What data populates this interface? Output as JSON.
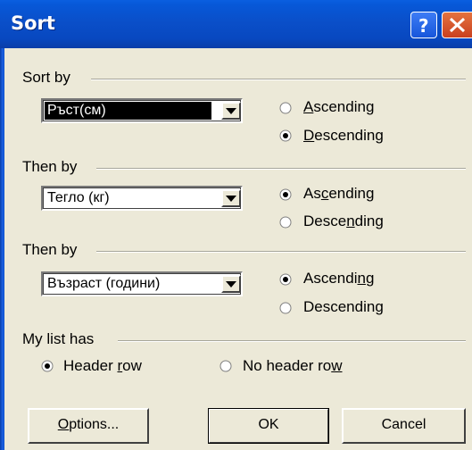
{
  "window": {
    "title": "Sort"
  },
  "sort_by": {
    "heading": "Sort by",
    "field": "Ръст(см)",
    "ascending": {
      "pre": "",
      "u": "A",
      "post": "scending",
      "checked": false
    },
    "descending": {
      "pre": "",
      "u": "D",
      "post": "escending",
      "checked": true
    }
  },
  "then_by_1": {
    "heading": "Then by",
    "field": "Тегло (кг)",
    "ascending": {
      "pre": "As",
      "u": "c",
      "post": "ending",
      "checked": true
    },
    "descending": {
      "pre": "Desce",
      "u": "n",
      "post": "ding",
      "checked": false
    }
  },
  "then_by_2": {
    "heading": "Then by",
    "field": "Възраст (години)",
    "ascending": {
      "pre": "Ascendi",
      "u": "n",
      "post": "g",
      "checked": true
    },
    "descending": {
      "pre": "Descendin",
      "u": "g",
      "post": "",
      "checked": false
    }
  },
  "header": {
    "heading": "My list has",
    "header_row": {
      "pre": "Header ",
      "u": "r",
      "post": "ow",
      "checked": true
    },
    "no_header_row": {
      "pre": "No header ro",
      "u": "w",
      "post": "",
      "checked": false
    }
  },
  "buttons": {
    "options": {
      "pre": "",
      "u": "O",
      "post": "ptions..."
    },
    "ok": "OK",
    "cancel": "Cancel"
  }
}
